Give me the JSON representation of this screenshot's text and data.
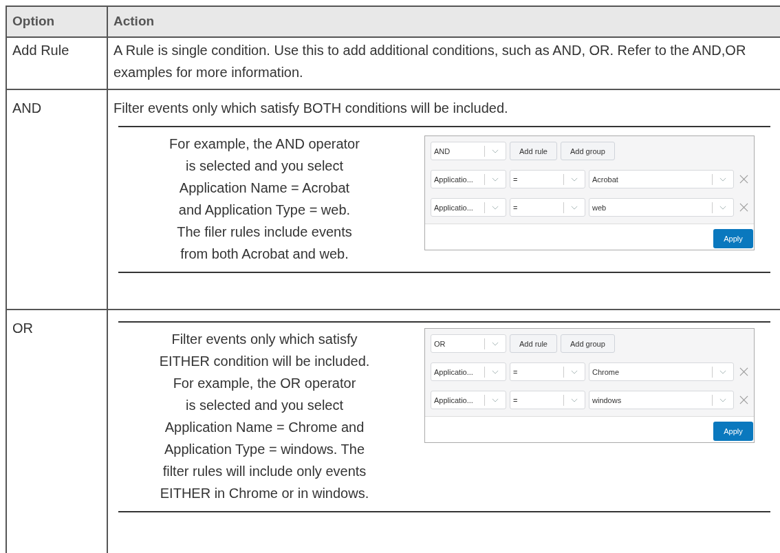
{
  "table": {
    "columns": [
      "Option",
      "Action"
    ],
    "rows": [
      {
        "option": "Add Rule",
        "action": "A Rule is single condition. Use this to add additional conditions, such as AND, OR. Refer to the AND,OR examples for more information."
      },
      {
        "option": "AND",
        "action": "Filter events only which satisfy BOTH conditions will be included.",
        "example": {
          "lines": [
            "For example, the AND operator",
            "is selected and you select",
            "Application Name = Acrobat",
            "and Application Type = web.",
            "The filer rules include events",
            "from both Acrobat and web."
          ],
          "filter": {
            "operator": "AND",
            "buttons": [
              "Add rule",
              "Add group"
            ],
            "rules": [
              {
                "field": "Applicatio...",
                "operator": "=",
                "value": "Acrobat"
              },
              {
                "field": "Applicatio...",
                "operator": "=",
                "value": "web"
              }
            ],
            "apply": "Apply"
          }
        }
      },
      {
        "option": "OR",
        "example": {
          "lines": [
            "Filter events only which satisfy",
            "EITHER condition will be included.",
            "For example, the OR operator",
            "is selected and you select",
            "Application Name = Chrome and",
            "Application Type = windows. The",
            "filter rules will include only events",
            "EITHER in Chrome or in windows."
          ],
          "filter": {
            "operator": "OR",
            "buttons": [
              "Add rule",
              "Add group"
            ],
            "rules": [
              {
                "field": "Applicatio...",
                "operator": "=",
                "value": "Chrome"
              },
              {
                "field": "Applicatio...",
                "operator": "=",
                "value": "windows"
              }
            ],
            "apply": "Apply"
          }
        }
      }
    ]
  }
}
